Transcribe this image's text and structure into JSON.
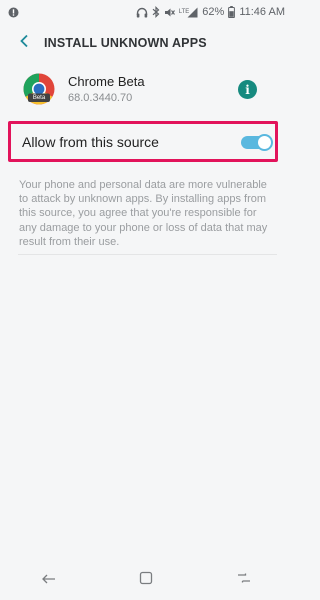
{
  "status_bar": {
    "network_label": "LTE",
    "battery": "62%",
    "time": "11:46 AM",
    "icons": [
      "alert-icon",
      "headphones-icon",
      "bluetooth-icon",
      "mute-icon",
      "signal-icon",
      "battery-icon"
    ]
  },
  "header": {
    "title": "INSTALL UNKNOWN APPS",
    "back_icon": "back-arrow-icon"
  },
  "app": {
    "name": "Chrome Beta",
    "version": "68.0.3440.70",
    "icon": "chrome-beta-icon",
    "icon_badge": "Beta",
    "info_icon": "info-icon"
  },
  "setting": {
    "label": "Allow from this source",
    "enabled": true,
    "highlight_color": "#e2135b",
    "toggle_color": "#5ab8df"
  },
  "description": "Your phone and personal data are more vulnerable to attack by unknown apps. By installing apps from this source, you agree that you're responsible for any damage to your phone or loss of data that may result from their use.",
  "nav_bar": {
    "icons": [
      "back-icon",
      "home-icon",
      "recents-icon"
    ]
  },
  "colors": {
    "background": "#f5f6f7",
    "info_button": "#168a7f"
  }
}
